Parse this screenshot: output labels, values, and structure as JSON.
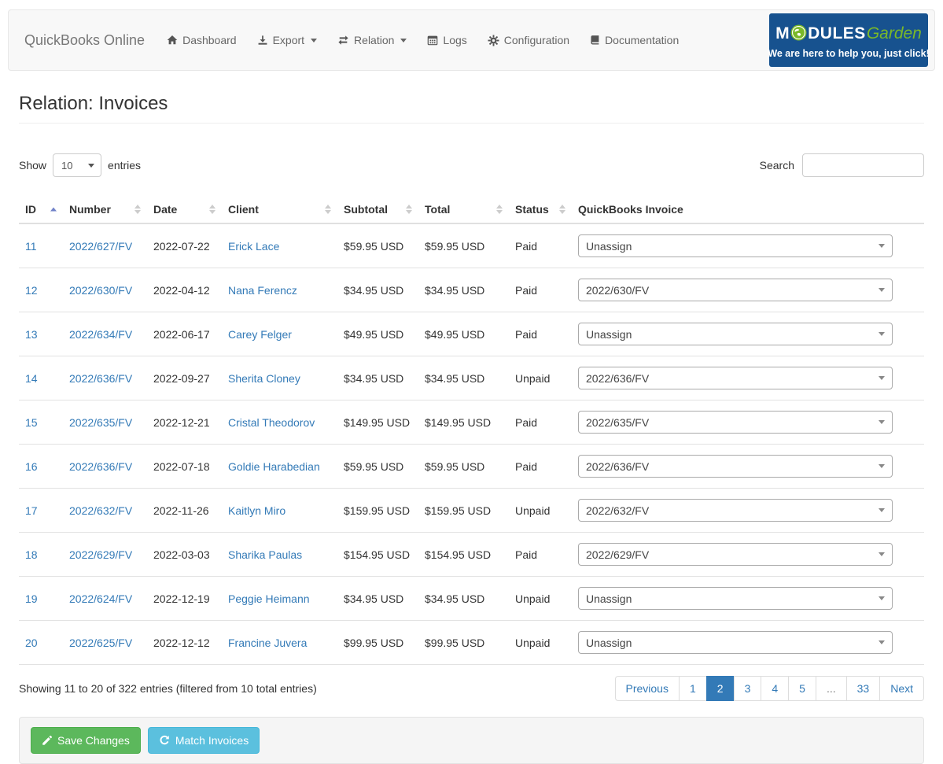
{
  "colors": {
    "link": "#337ab7",
    "pagination_active": "#337ab7",
    "save_button": "#5cb85c",
    "match_button": "#5bc0de",
    "banner_blue": "#17528f",
    "banner_green": "#7ab829",
    "navbar_bg": "#f8f8f8",
    "sort_active_arrow": "#7283c9"
  },
  "navbar": {
    "brand": "QuickBooks Online",
    "items": [
      {
        "label": "Dashboard",
        "icon": "home-icon",
        "caret": false
      },
      {
        "label": "Export",
        "icon": "download-icon",
        "caret": true
      },
      {
        "label": "Relation",
        "icon": "exchange-icon",
        "caret": true
      },
      {
        "label": "Logs",
        "icon": "calendar-icon",
        "caret": false
      },
      {
        "label": "Configuration",
        "icon": "gear-icon",
        "caret": false
      },
      {
        "label": "Documentation",
        "icon": "book-icon",
        "caret": false
      }
    ],
    "banner": {
      "modules_prefix": "M",
      "modules_suffix": "DULES",
      "garden": "Garden",
      "tagline": "We are here to help you, just click!"
    }
  },
  "page": {
    "title": "Relation: Invoices"
  },
  "table_controls": {
    "show_label": "Show",
    "page_size": "10",
    "entries_label": "entries",
    "search_label": "Search",
    "search_value": ""
  },
  "table": {
    "columns": [
      {
        "label": "ID",
        "sort": "asc"
      },
      {
        "label": "Number",
        "sort": "both"
      },
      {
        "label": "Date",
        "sort": "both"
      },
      {
        "label": "Client",
        "sort": "both"
      },
      {
        "label": "Subtotal",
        "sort": "both"
      },
      {
        "label": "Total",
        "sort": "both"
      },
      {
        "label": "Status",
        "sort": "both"
      },
      {
        "label": "QuickBooks Invoice",
        "sort": "none"
      }
    ],
    "rows": [
      {
        "id": "11",
        "number": "2022/627/FV",
        "date": "2022-07-22",
        "client": "Erick Lace",
        "subtotal": "$59.95 USD",
        "total": "$59.95 USD",
        "status": "Paid",
        "qb_invoice": "Unassign"
      },
      {
        "id": "12",
        "number": "2022/630/FV",
        "date": "2022-04-12",
        "client": "Nana Ferencz",
        "subtotal": "$34.95 USD",
        "total": "$34.95 USD",
        "status": "Paid",
        "qb_invoice": "2022/630/FV"
      },
      {
        "id": "13",
        "number": "2022/634/FV",
        "date": "2022-06-17",
        "client": "Carey Felger",
        "subtotal": "$49.95 USD",
        "total": "$49.95 USD",
        "status": "Paid",
        "qb_invoice": "Unassign"
      },
      {
        "id": "14",
        "number": "2022/636/FV",
        "date": "2022-09-27",
        "client": "Sherita Cloney",
        "subtotal": "$34.95 USD",
        "total": "$34.95 USD",
        "status": "Unpaid",
        "qb_invoice": "2022/636/FV"
      },
      {
        "id": "15",
        "number": "2022/635/FV",
        "date": "2022-12-21",
        "client": "Cristal Theodorov",
        "subtotal": "$149.95 USD",
        "total": "$149.95 USD",
        "status": "Paid",
        "qb_invoice": "2022/635/FV"
      },
      {
        "id": "16",
        "number": "2022/636/FV",
        "date": "2022-07-18",
        "client": "Goldie Harabedian",
        "subtotal": "$59.95 USD",
        "total": "$59.95 USD",
        "status": "Paid",
        "qb_invoice": "2022/636/FV"
      },
      {
        "id": "17",
        "number": "2022/632/FV",
        "date": "2022-11-26",
        "client": "Kaitlyn Miro",
        "subtotal": "$159.95 USD",
        "total": "$159.95 USD",
        "status": "Unpaid",
        "qb_invoice": "2022/632/FV"
      },
      {
        "id": "18",
        "number": "2022/629/FV",
        "date": "2022-03-03",
        "client": "Sharika Paulas",
        "subtotal": "$154.95 USD",
        "total": "$154.95 USD",
        "status": "Paid",
        "qb_invoice": "2022/629/FV"
      },
      {
        "id": "19",
        "number": "2022/624/FV",
        "date": "2022-12-19",
        "client": "Peggie Heimann",
        "subtotal": "$34.95 USD",
        "total": "$34.95 USD",
        "status": "Unpaid",
        "qb_invoice": "Unassign"
      },
      {
        "id": "20",
        "number": "2022/625/FV",
        "date": "2022-12-12",
        "client": "Francine Juvera",
        "subtotal": "$99.95 USD",
        "total": "$99.95 USD",
        "status": "Unpaid",
        "qb_invoice": "Unassign"
      }
    ]
  },
  "footer": {
    "summary": "Showing 11 to 20 of 322 entries (filtered from 10 total entries)",
    "pagination": [
      "Previous",
      "1",
      "2",
      "3",
      "4",
      "5",
      "...",
      "33",
      "Next"
    ],
    "active_page": "2"
  },
  "actions": {
    "save_label": "Save Changes",
    "match_label": "Match Invoices"
  }
}
